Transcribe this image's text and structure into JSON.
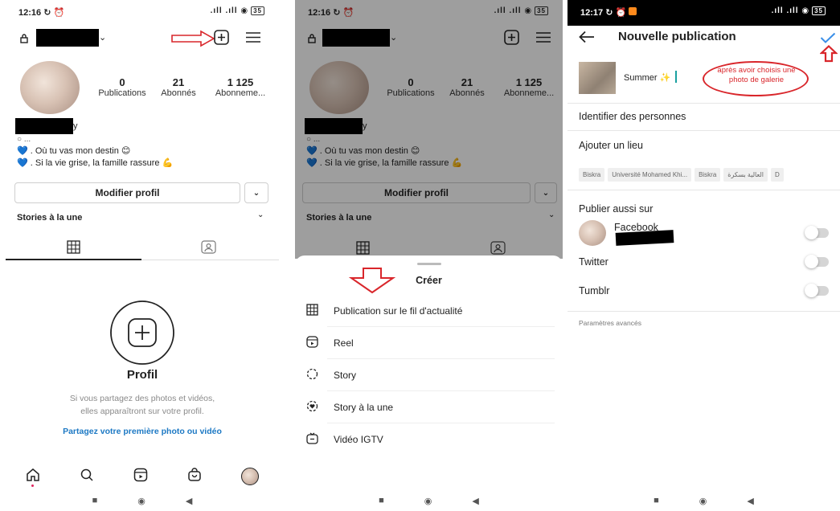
{
  "colors": {
    "link_blue": "#1d79c4",
    "annotation_red": "#d9262b",
    "check_blue": "#3a8fe8",
    "heart_blue": "#2f6fd1"
  },
  "screen1": {
    "status": {
      "time": "12:16 ↻ ⏰",
      "icons": ".ıll .ıll ◉",
      "battery": "35"
    },
    "header": {
      "lock_icon": "lock-icon",
      "add_icon": "plus-square-icon",
      "menu_icon": "hamburger-icon"
    },
    "stats": [
      {
        "value": "0",
        "label": "Publications"
      },
      {
        "value": "21",
        "label": "Abonnés"
      },
      {
        "value": "1 125",
        "label": "Abonneme..."
      }
    ],
    "bio": {
      "line1": "○ ...",
      "line2": "💙 . Où tu vas mon destin 😊",
      "line3": "💙 . Si la vie grise, la famille rassure 💪",
      "name_tail": "y"
    },
    "edit_profile": "Modifier profil",
    "highlights": "Stories à la une",
    "empty": {
      "title": "Profil",
      "text1": "Si vous partagez des photos et vidéos,",
      "text2": "elles apparaîtront sur votre profil.",
      "link": "Partagez votre première photo ou vidéo"
    }
  },
  "screen2": {
    "status": {
      "time": "12:16 ↻ ⏰",
      "icons": ".ıll .ıll ◉",
      "battery": "35"
    },
    "stats": [
      {
        "value": "0",
        "label": "Publications"
      },
      {
        "value": "21",
        "label": "Abonnés"
      },
      {
        "value": "1 125",
        "label": "Abonneme..."
      }
    ],
    "bio": {
      "line1": "○ ...",
      "line2": "💙 . Où tu vas mon destin 😊",
      "line3": "💙 . Si la vie grise, la famille rassure 💪",
      "name_tail": "y"
    },
    "edit_profile": "Modifier profil",
    "highlights": "Stories à la une",
    "sheet": {
      "title": "Créer",
      "items": [
        {
          "icon": "grid-icon",
          "glyph": "⊞",
          "label": "Publication sur le fil d'actualité"
        },
        {
          "icon": "reel-icon",
          "glyph": "▶",
          "label": "Reel"
        },
        {
          "icon": "story-icon",
          "glyph": "◌",
          "label": "Story"
        },
        {
          "icon": "highlight-icon",
          "glyph": "❤",
          "label": "Story à la une"
        },
        {
          "icon": "igtv-icon",
          "glyph": "📺",
          "label": "Vidéo IGTV"
        }
      ]
    }
  },
  "screen3": {
    "status": {
      "time": "12:17 ↻ ⏰",
      "icons": ".ıll .ıll ◉",
      "battery": "35"
    },
    "header": {
      "title": "Nouvelle publication"
    },
    "caption": "Summer ✨",
    "annotation": "après avoir choisis une photo de galerie",
    "tag_people": "Identifier des personnes",
    "add_location": "Ajouter un lieu",
    "chips": [
      "Biskra",
      "Université Mohamed Khi...",
      "Biskra",
      "العالية بسكرة",
      "D"
    ],
    "publish_also": "Publier aussi sur",
    "networks": [
      "Facebook",
      "Twitter",
      "Tumblr"
    ],
    "advanced": "Paramètres avancés"
  }
}
